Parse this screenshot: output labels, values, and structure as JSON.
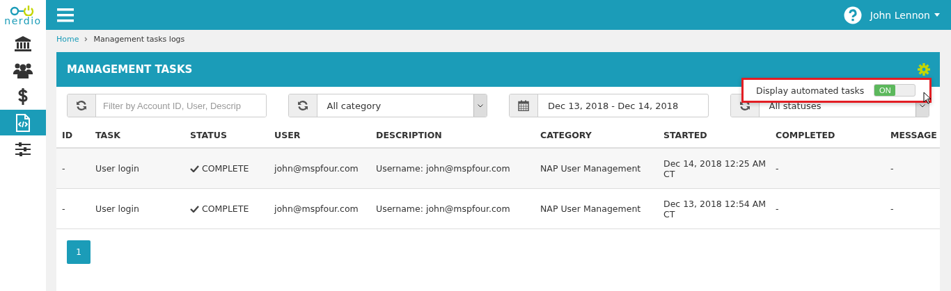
{
  "logo": {
    "text": "nerdio"
  },
  "sidebar": {
    "items": [
      {
        "kind": "bank",
        "selected": false
      },
      {
        "kind": "users",
        "selected": false
      },
      {
        "kind": "dollar",
        "selected": false
      },
      {
        "kind": "code",
        "selected": true
      },
      {
        "kind": "sliders",
        "selected": false
      }
    ]
  },
  "user_menu": {
    "name": "John Lennon"
  },
  "breadcrumb": [
    "Home",
    "Management tasks logs"
  ],
  "panel": {
    "title": "MANAGEMENT TASKS"
  },
  "filters": [
    {
      "kind": "text",
      "placeholder": "Filter by Account ID, User, Descrip"
    },
    {
      "kind": "select",
      "value": "All category"
    },
    {
      "kind": "date",
      "value": "Dec 13, 2018 - Dec 14, 2018"
    },
    {
      "kind": "select",
      "value": "All statuses"
    }
  ],
  "popup": {
    "label": "Display automated tasks",
    "toggle": {
      "on": true,
      "text": "ON"
    }
  },
  "table": {
    "columns": [
      "ID",
      "TASK",
      "STATUS",
      "USER",
      "DESCRIPTION",
      "CATEGORY",
      "STARTED",
      "COMPLETED",
      "MESSAGE"
    ],
    "rows": [
      {
        "cells": [
          "-",
          "User login",
          "COMPLETE",
          "john@mspfour.com",
          "Username: john@mspfour.com",
          "NAP User Management",
          "Dec 14, 2018 12:25 AM CT",
          "-",
          "-"
        ]
      },
      {
        "cells": [
          "-",
          "User login",
          "COMPLETE",
          "john@mspfour.com",
          "Username: john@mspfour.com",
          "NAP User Management",
          "Dec 13, 2018 12:54 AM CT",
          "-",
          "-"
        ]
      }
    ]
  },
  "pagination": [
    {
      "label": "1",
      "selected": true
    }
  ]
}
